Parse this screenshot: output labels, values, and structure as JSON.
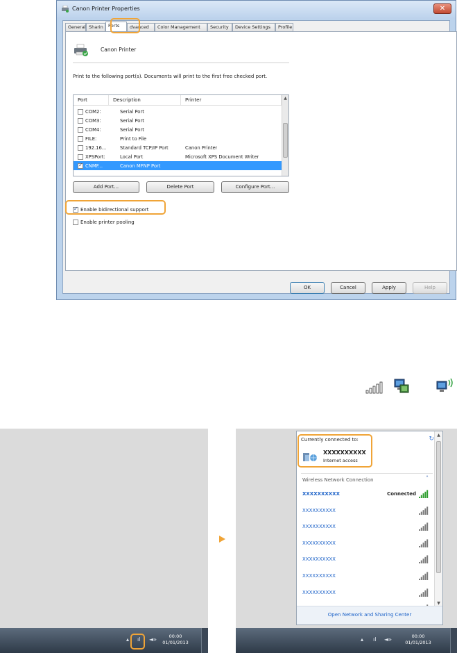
{
  "dialog": {
    "title": "Canon Printer Properties",
    "close_glyph": "✕",
    "tabs": [
      {
        "label": "General"
      },
      {
        "label": "Sharin"
      },
      {
        "label": "Ports",
        "active": true
      },
      {
        "label": "dvanced"
      },
      {
        "label": "Color Management"
      },
      {
        "label": "Security"
      },
      {
        "label": "Device Settings"
      },
      {
        "label": "Profile"
      }
    ],
    "printer_name": "Canon Printer",
    "instructions": "Print to the following port(s). Documents will print to the first free checked port.",
    "columns": [
      "Port",
      "Description",
      "Printer"
    ],
    "ports": [
      {
        "port": "COM2:",
        "description": "Serial Port",
        "printer": "",
        "checked": false,
        "selected": false
      },
      {
        "port": "COM3:",
        "description": "Serial Port",
        "printer": "",
        "checked": false,
        "selected": false
      },
      {
        "port": "COM4:",
        "description": "Serial Port",
        "printer": "",
        "checked": false,
        "selected": false
      },
      {
        "port": "FILE:",
        "description": "Print to File",
        "printer": "",
        "checked": false,
        "selected": false
      },
      {
        "port": "192.16...",
        "description": "Standard TCP/IP Port",
        "printer": "Canon Printer",
        "checked": false,
        "selected": false
      },
      {
        "port": "XPSPort:",
        "description": "Local Port",
        "printer": "Microsoft XPS Document Writer",
        "checked": false,
        "selected": false
      },
      {
        "port": "CNMF...",
        "description": "Canon MFNP Port",
        "printer": "",
        "checked": true,
        "selected": true
      }
    ],
    "add_port": "Add Port...",
    "delete_port": "Delete Port",
    "configure_port": "Configure Port...",
    "bidirectional": {
      "label": "Enable bidirectional support",
      "checked": true
    },
    "pooling": {
      "label": "Enable printer pooling",
      "checked": false
    },
    "ok": "OK",
    "cancel": "Cancel",
    "apply": "Apply",
    "help": "Help",
    "highlight_color": "#f0a437"
  },
  "icons": [
    "signal-bars-icon",
    "network-computer-icon",
    "wireless-computer-icon"
  ],
  "taskbar_left": {
    "time": "00:00",
    "date": "01/01/2013",
    "glyphs": [
      "▴",
      "ıl",
      "◄»"
    ]
  },
  "taskbar_right": {
    "time": "00:00",
    "date": "01/01/2013",
    "glyphs": [
      "▴",
      "ıl",
      "◄»"
    ]
  },
  "flyout": {
    "currently_connected": "Currently connected to:",
    "refresh_glyph": "↻",
    "connected_network": "XXXXXXXXXX",
    "connected_status": "Internet access",
    "section_title": "Wireless Network Connection",
    "collapse_glyph": "˄",
    "networks": [
      {
        "name": "XXXXXXXXXX",
        "status": "Connected",
        "bold": true
      },
      {
        "name": "XXXXXXXXXX",
        "status": "",
        "bold": false
      },
      {
        "name": "XXXXXXXXXX",
        "status": "",
        "bold": false
      },
      {
        "name": "XXXXXXXXXX",
        "status": "",
        "bold": false
      },
      {
        "name": "XXXXXXXXXX",
        "status": "",
        "bold": false
      },
      {
        "name": "XXXXXXXXXX",
        "status": "",
        "bold": false
      },
      {
        "name": "XXXXXXXXXX",
        "status": "",
        "bold": false
      },
      {
        "name": "XXXXXXXXXX",
        "status": "",
        "bold": false
      }
    ],
    "footer_link": "Open Network and Sharing Center"
  }
}
